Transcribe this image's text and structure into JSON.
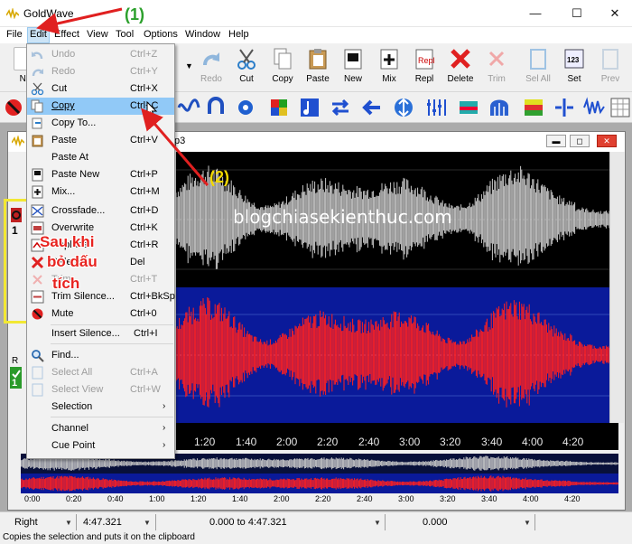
{
  "window": {
    "title": "GoldWave",
    "minimize": "—",
    "maximize": "☐",
    "close": "✕"
  },
  "menubar": [
    "File",
    "Edit",
    "Effect",
    "View",
    "Tool",
    "Options",
    "Window",
    "Help"
  ],
  "toolbar": {
    "buttons": [
      {
        "label": "Ne",
        "icon": "new-icon",
        "enabled": true
      },
      {
        "label": "Redo",
        "icon": "redo-icon",
        "enabled": false
      },
      {
        "label": "Cut",
        "icon": "scissors-icon",
        "enabled": true
      },
      {
        "label": "Copy",
        "icon": "copy-icon",
        "enabled": true
      },
      {
        "label": "Paste",
        "icon": "paste-icon",
        "enabled": true
      },
      {
        "label": "New",
        "icon": "paste-new-icon",
        "enabled": true
      },
      {
        "label": "Mix",
        "icon": "mix-icon",
        "enabled": true
      },
      {
        "label": "Repl",
        "icon": "replace-icon",
        "enabled": true
      },
      {
        "label": "Delete",
        "icon": "delete-icon",
        "enabled": true
      },
      {
        "label": "Trim",
        "icon": "trim-icon",
        "enabled": false
      },
      {
        "label": "Sel All",
        "icon": "select-all-icon",
        "enabled": false
      },
      {
        "label": "Set",
        "icon": "set-icon",
        "enabled": true
      },
      {
        "label": "Prev",
        "icon": "prev-icon",
        "enabled": false
      }
    ]
  },
  "edit_menu": {
    "items": [
      {
        "label": "Undo",
        "shortcut": "Ctrl+Z",
        "enabled": false,
        "icon": "undo-icon"
      },
      {
        "label": "Redo",
        "shortcut": "Ctrl+Y",
        "enabled": false,
        "icon": "redo-icon"
      },
      {
        "label": "Cut",
        "shortcut": "Ctrl+X",
        "enabled": true,
        "icon": "scissors-icon"
      },
      {
        "label": "Copy",
        "shortcut": "Ctrl+C",
        "enabled": true,
        "icon": "copy-icon",
        "highlighted": true
      },
      {
        "label": "Copy To...",
        "shortcut": "",
        "enabled": true,
        "icon": "copy-to-icon"
      },
      {
        "label": "Paste",
        "shortcut": "Ctrl+V",
        "enabled": true,
        "icon": "paste-icon"
      },
      {
        "label": "Paste At",
        "shortcut": "",
        "enabled": true,
        "icon": ""
      },
      {
        "label": "Paste New",
        "shortcut": "Ctrl+P",
        "enabled": true,
        "icon": "paste-new-icon"
      },
      {
        "label": "Mix...",
        "shortcut": "Ctrl+M",
        "enabled": true,
        "icon": "mix-icon"
      },
      {
        "label": "Crossfade...",
        "shortcut": "Ctrl+D",
        "enabled": true,
        "icon": "crossfade-icon"
      },
      {
        "label": "Overwrite",
        "shortcut": "Ctrl+K",
        "enabled": true,
        "icon": "overwrite-icon"
      },
      {
        "label": "Replace",
        "shortcut": "Ctrl+R",
        "enabled": true,
        "icon": "replace-icon"
      },
      {
        "label": "Delete",
        "shortcut": "Del",
        "enabled": true,
        "icon": "delete-icon"
      },
      {
        "label": "Trim",
        "shortcut": "Ctrl+T",
        "enabled": false,
        "icon": "trim-icon"
      },
      {
        "label": "Trim Silence...",
        "shortcut": "Ctrl+BkSp",
        "enabled": true,
        "icon": "trim-silence-icon"
      },
      {
        "label": "Mute",
        "shortcut": "Ctrl+0",
        "enabled": true,
        "icon": "mute-icon"
      },
      {
        "label": "Insert Silence...",
        "shortcut": "Ctrl+I",
        "enabled": true,
        "icon": ""
      },
      {
        "label": "Find...",
        "shortcut": "",
        "enabled": true,
        "icon": "find-icon"
      },
      {
        "label": "Select All",
        "shortcut": "Ctrl+A",
        "enabled": false,
        "icon": "select-all-icon"
      },
      {
        "label": "Select View",
        "shortcut": "Ctrl+W",
        "enabled": false,
        "icon": "select-view-icon"
      },
      {
        "label": "Selection",
        "shortcut": "",
        "enabled": true,
        "icon": "",
        "submenu": true
      },
      {
        "label": "Channel",
        "shortcut": "",
        "enabled": true,
        "icon": "",
        "submenu": true
      },
      {
        "label": "Cue Point",
        "shortcut": "",
        "enabled": true,
        "icon": "",
        "submenu": true
      }
    ]
  },
  "document": {
    "title": "p3",
    "channel_labels": [
      "1",
      "R",
      "1"
    ]
  },
  "timeline": [
    "1:20",
    "1:40",
    "2:00",
    "2:20",
    "2:40",
    "3:00",
    "3:20",
    "3:40",
    "4:00",
    "4:20"
  ],
  "overview_ruler": [
    "0:00",
    "0:20",
    "0:40",
    "1:00",
    "1:20",
    "1:40",
    "2:00",
    "2:20",
    "2:40",
    "3:00",
    "3:20",
    "3:40",
    "4:00",
    "4:20"
  ],
  "statusbar": {
    "channel": "Right",
    "length": "4:47.321",
    "selection": "0.000 to 4:47.321",
    "position": "0.000",
    "help": "Copies the selection and puts it on the clipboard"
  },
  "annotations": {
    "marker1": "(1)",
    "marker2": "(2)",
    "note_line1": "Sau khi",
    "note_line2": "bỏ dấu",
    "note_line3": "tích",
    "watermark": "blogchiasekienthuc.com"
  },
  "colors": {
    "highlight": "#91c9f7",
    "wave_top": "#c8c8c8",
    "wave_bottom": "#ff2020",
    "note_red": "#e8231f",
    "marker_green": "#2ca02c",
    "marker_yellow": "#f2e833"
  }
}
